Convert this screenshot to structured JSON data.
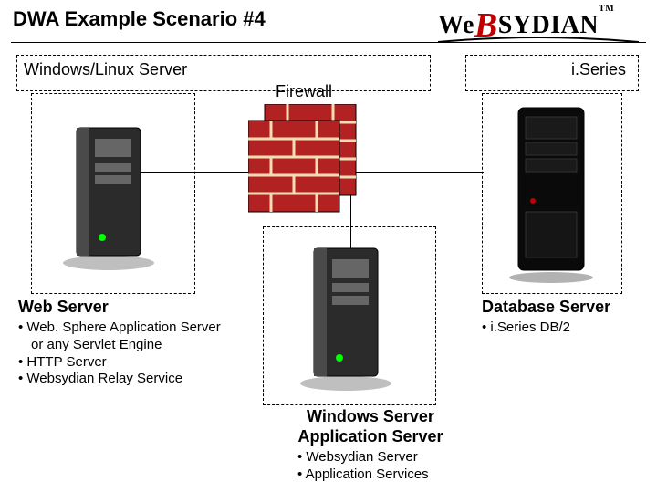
{
  "title": "DWA Example Scenario #4",
  "logo": {
    "brand": "WeBSYDIAN",
    "tm": "TM"
  },
  "groups": {
    "winlinux": {
      "label": "Windows/Linux Server"
    },
    "iseries": {
      "label": "i.Series"
    }
  },
  "firewall": {
    "label": "Firewall"
  },
  "web_server": {
    "caption": "Web Server",
    "bullets": [
      "Web. Sphere Application Server",
      "or any Servlet Engine",
      "HTTP Server",
      "Websydian Relay Service"
    ]
  },
  "app_server": {
    "caption_top": "Windows Server",
    "caption": "Application Server",
    "bullets": [
      "Websydian Server",
      "Application Services"
    ]
  },
  "db_server": {
    "caption": "Database Server",
    "bullets": [
      "i.Series DB/2"
    ]
  }
}
